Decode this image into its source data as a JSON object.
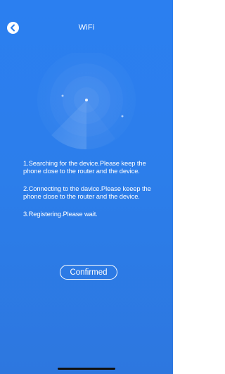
{
  "header": {
    "title": "WiFi",
    "back_icon": "chevron-left-icon"
  },
  "instructions": {
    "steps": [
      "1.Searching for the device.Please keep the phone close to the router and the device.",
      "2.Connecting to the davice.Please keeep the phone close to the router and the device.",
      "3.Registering.Please wait."
    ]
  },
  "confirm_button": {
    "label": "Confirmed"
  },
  "colors": {
    "background": "#2c7eeb",
    "text": "#ffffff"
  }
}
